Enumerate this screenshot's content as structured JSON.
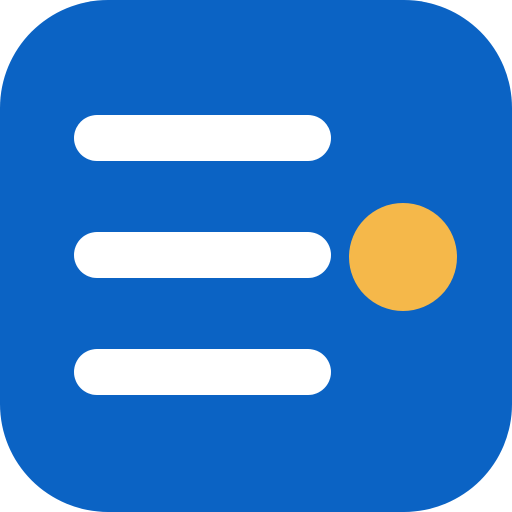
{
  "icon": {
    "name": "list-icon-with-notification",
    "colors": {
      "background": "#0b63c4",
      "bars": "#ffffff",
      "notification_dot": "#f5b84a"
    },
    "elements": {
      "bars": [
        "menu-line",
        "menu-line",
        "menu-line"
      ],
      "indicator": "notification-dot"
    }
  }
}
